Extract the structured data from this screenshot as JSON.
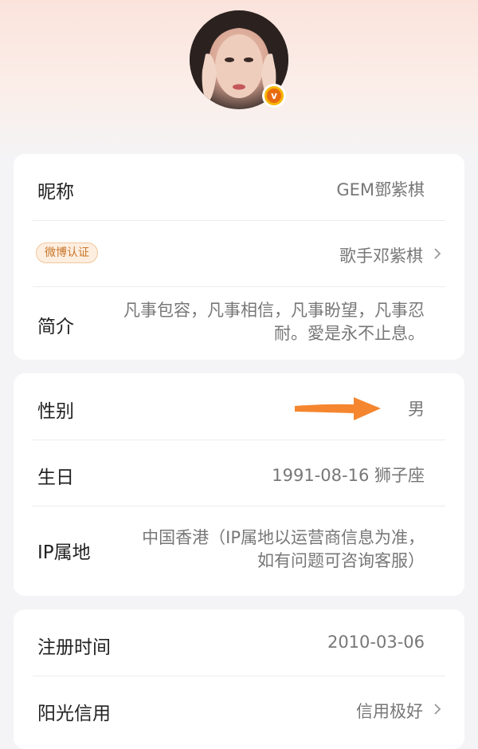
{
  "profile": {
    "avatar_icon": "profile-photo",
    "verified_icon": "verified-v-icon",
    "verified_glyph": "v"
  },
  "basic_info": {
    "nickname_label": "昵称",
    "nickname_value": "GEM鄧紫棋",
    "verify_badge": "微博认证",
    "verify_value": "歌手邓紫棋",
    "bio_label": "简介",
    "bio_value": "凡事包容，凡事相信，凡事盼望，凡事忍耐。愛是永不止息。"
  },
  "personal_info": {
    "gender_label": "性别",
    "gender_value": "男",
    "birthday_label": "生日",
    "birthday_value": "1991-08-16 狮子座",
    "ip_label": "IP属地",
    "ip_value": "中国香港（IP属地以运营商信息为准，如有问题可咨询客服）"
  },
  "account_info": {
    "register_label": "注册时间",
    "register_value": "2010-03-06",
    "credit_label": "阳光信用",
    "credit_value": "信用极好"
  },
  "colors": {
    "accent_orange": "#f5862f",
    "badge_bg": "#fdeee0",
    "badge_text": "#c9762a",
    "verified_gold": "#f7b500"
  },
  "annotation": {
    "arrow_icon": "orange-right-arrow"
  }
}
